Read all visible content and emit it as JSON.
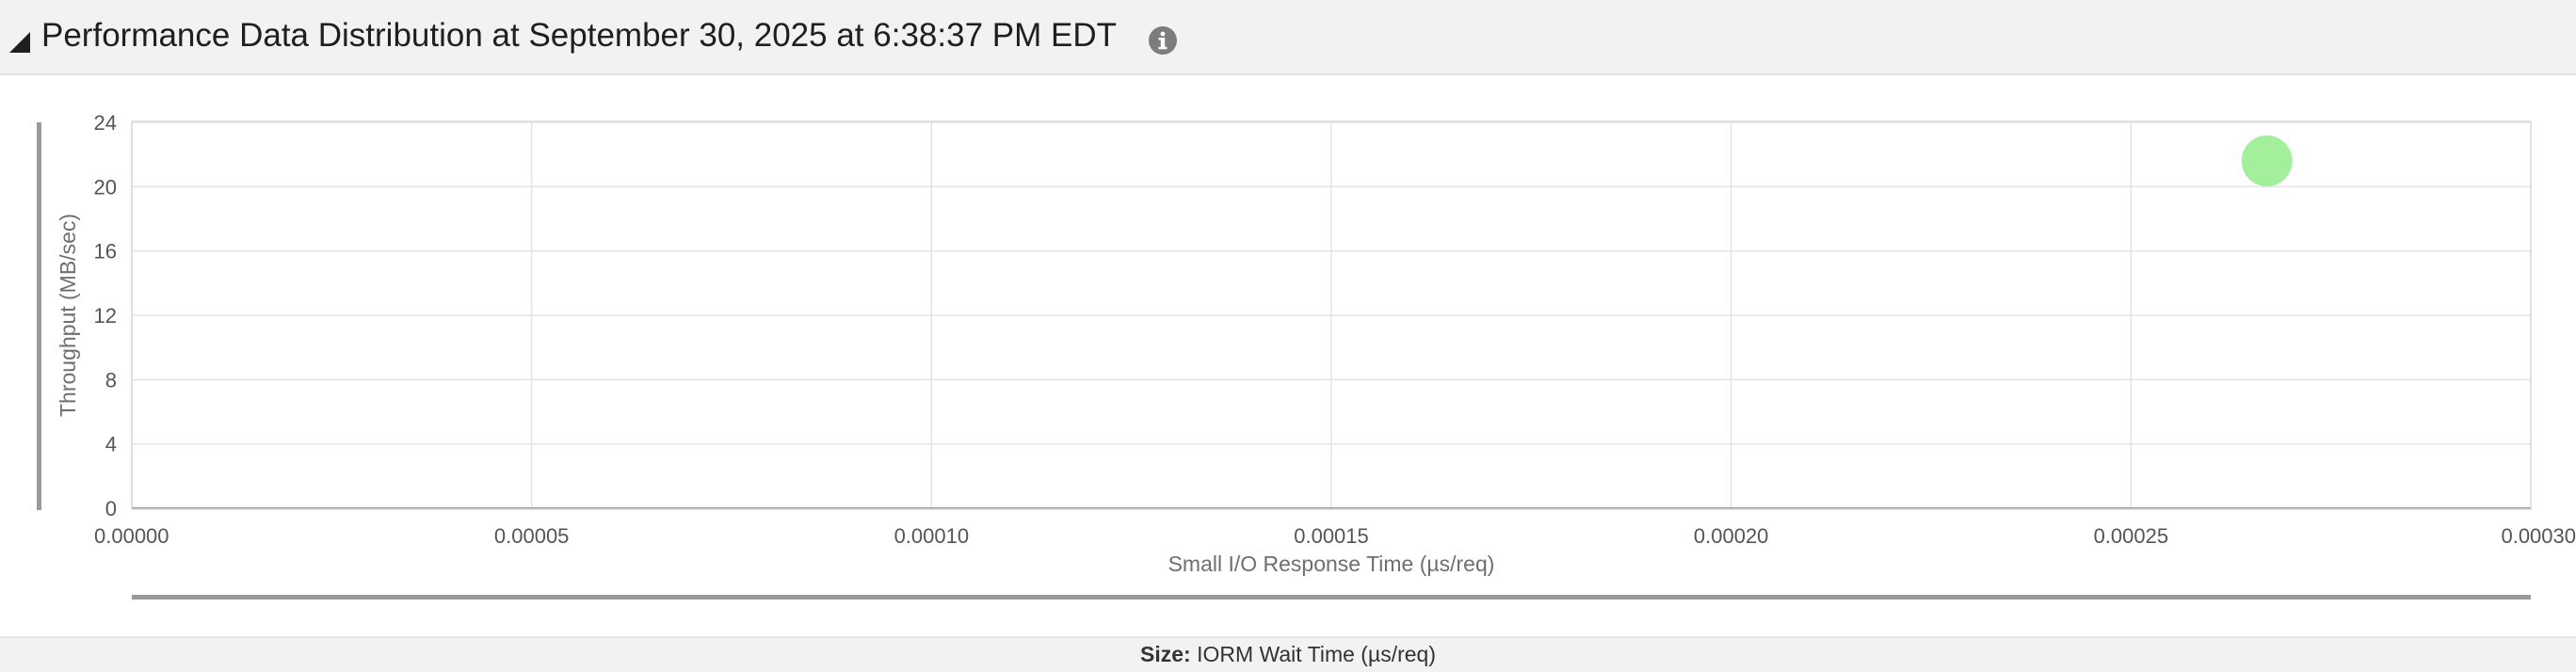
{
  "header": {
    "title": "Performance Data Distribution at September 30, 2025 at 6:38:37 PM EDT",
    "collapse_icon": "collapse-triangle-icon",
    "info_icon": "info-icon"
  },
  "chart_data": {
    "type": "scatter",
    "xlabel": "Small I/O Response Time (µs/req)",
    "ylabel": "Throughput (MB/sec)",
    "xlim": [
      0,
      0.0003
    ],
    "ylim": [
      0,
      24
    ],
    "xticks": [
      "0.00000",
      "0.00005",
      "0.00010",
      "0.00015",
      "0.00020",
      "0.00025",
      "0.00030"
    ],
    "yticks": [
      "0",
      "4",
      "8",
      "12",
      "16",
      "20",
      "24"
    ],
    "grid": true,
    "points": [
      {
        "x": 0.000267,
        "y": 21.6,
        "color": "#a3ef9b"
      }
    ]
  },
  "footer": {
    "size_label": "Size:",
    "size_value": "IORM Wait Time (µs/req)"
  }
}
